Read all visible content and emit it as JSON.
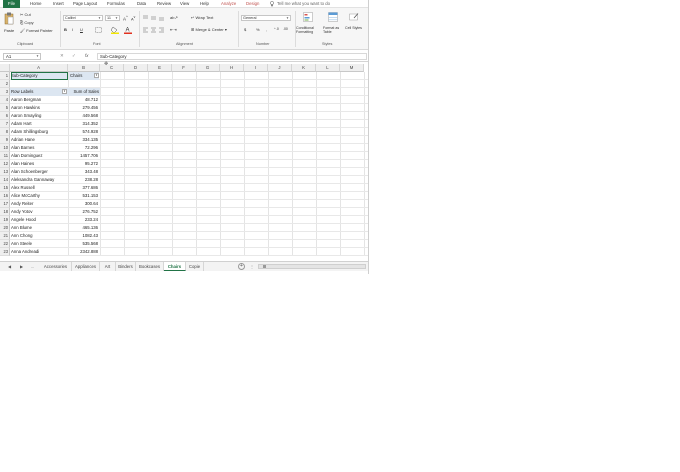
{
  "menu": {
    "items": [
      "File",
      "Home",
      "Insert",
      "Page Layout",
      "Formulas",
      "Data",
      "Review",
      "View",
      "Help",
      "Analyze",
      "Design"
    ],
    "tell_me": "Tell me what you want to do"
  },
  "ribbon": {
    "paste": "Paste",
    "cut": "Cut",
    "copy": "Copy",
    "format_painter": "Format Painter",
    "font_name": "Calibri",
    "font_size": "11",
    "bold": "B",
    "italic": "I",
    "underline": "U",
    "wrap_text": "Wrap Text",
    "merge_center": "Merge & Center",
    "number_format": "General",
    "currency": "$",
    "percent": "%",
    "comma": ",",
    "conditional_formatting": "Conditional Formatting",
    "format_as_table": "Format as Table",
    "cell_styles": "Cell Styles",
    "groups": [
      "Clipboard",
      "Font",
      "Alignment",
      "Number",
      "Styles"
    ]
  },
  "formula_bar": {
    "name_box": "A1",
    "cancel": "✕",
    "enter": "✓",
    "fx": "fx",
    "content": "Sub-Category"
  },
  "columns": [
    "A",
    "B",
    "C",
    "D",
    "E",
    "F",
    "G",
    "H",
    "I",
    "J",
    "K",
    "L",
    "M"
  ],
  "rows": [
    {
      "num": "1",
      "a": "Sub-Category",
      "b": "Chairs",
      "type": "filter"
    },
    {
      "num": "2",
      "a": "",
      "b": ""
    },
    {
      "num": "3",
      "a": "Row Labels",
      "b": "Sum of Sales",
      "type": "header"
    },
    {
      "num": "4",
      "a": "Aaron Bergman",
      "b": "48.712"
    },
    {
      "num": "5",
      "a": "Aaron Hawkins",
      "b": "279.456"
    },
    {
      "num": "6",
      "a": "Aaron Smayling",
      "b": "449.568"
    },
    {
      "num": "7",
      "a": "Adam Hart",
      "b": "314.352"
    },
    {
      "num": "8",
      "a": "Adam Shillingsburg",
      "b": "574.928"
    },
    {
      "num": "9",
      "a": "Adrian Hane",
      "b": "334.135"
    },
    {
      "num": "10",
      "a": "Alan Barnes",
      "b": "72.296"
    },
    {
      "num": "11",
      "a": "Alan Dominguez",
      "b": "1457.706"
    },
    {
      "num": "12",
      "a": "Alan Haines",
      "b": "95.272"
    },
    {
      "num": "13",
      "a": "Alan Schoenberger",
      "b": "343.48"
    },
    {
      "num": "14",
      "a": "Aleksandra Gannaway",
      "b": "238.28"
    },
    {
      "num": "15",
      "a": "Alex Russell",
      "b": "377.686"
    },
    {
      "num": "16",
      "a": "Alice McCarthy",
      "b": "531.153"
    },
    {
      "num": "17",
      "a": "Andy Reiter",
      "b": "300.64"
    },
    {
      "num": "18",
      "a": "Andy Yotov",
      "b": "276.752"
    },
    {
      "num": "19",
      "a": "Angele Hood",
      "b": "233.24"
    },
    {
      "num": "20",
      "a": "Ann Blume",
      "b": "465.136"
    },
    {
      "num": "21",
      "a": "Ann Chong",
      "b": "1082.43"
    },
    {
      "num": "22",
      "a": "Ann Steele",
      "b": "535.568"
    },
    {
      "num": "23",
      "a": "Anna Andreadi",
      "b": "2342.888"
    }
  ],
  "tabs": {
    "nav_prev": "◀",
    "nav_next": "▶",
    "more": "...",
    "sheets": [
      "Accessories",
      "Appliances",
      "Art",
      "Binders",
      "Bookcases",
      "Chairs",
      "Copie"
    ],
    "active": "Chairs",
    "add": "+"
  },
  "colors": {
    "accent": "#217346",
    "header_fill": "#dce6f1",
    "context_tab": "#c0504d"
  }
}
